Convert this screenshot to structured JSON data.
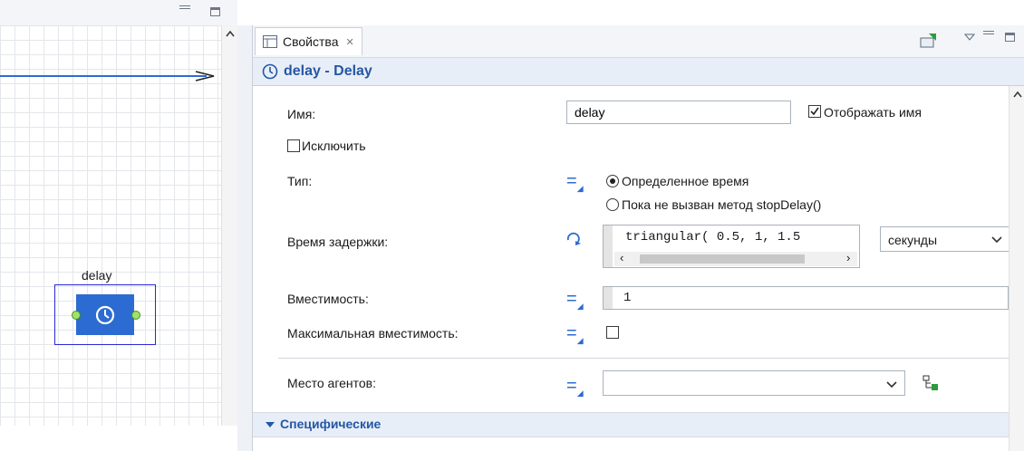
{
  "tab": {
    "label": "Свойства",
    "close": "✕"
  },
  "title": {
    "text": "delay - Delay"
  },
  "canvas": {
    "block_label": "delay"
  },
  "fields": {
    "name_label": "Имя:",
    "name_value": "delay",
    "show_name_label": "Отображать имя",
    "show_name_checked": true,
    "exclude_label": "Исключить",
    "exclude_checked": false,
    "type_label": "Тип:",
    "type_options": [
      "Определенное время",
      "Пока не вызван метод stopDelay()"
    ],
    "type_selected": 0,
    "delay_time_label": "Время задержки:",
    "delay_time_value": "triangular( 0.5, 1, 1.5",
    "delay_unit": "секунды",
    "capacity_label": "Вместимость:",
    "capacity_value": "1",
    "max_capacity_label": "Максимальная вместимость:",
    "max_capacity_checked": false,
    "agent_location_label": "Место агентов:",
    "agent_location_value": ""
  },
  "section": {
    "label": "Специфические"
  },
  "colors": {
    "accent": "#2357a5",
    "block_fill": "#2c6bd1",
    "canvas_grid": "#e3e6ea"
  },
  "icons": [
    "minimize-icon",
    "maximize-icon",
    "properties-tab-icon",
    "close-icon",
    "clock-icon",
    "equals-icon",
    "reload-icon",
    "dropdown-arrow-icon",
    "agent-location-icon",
    "section-collapse-icon"
  ]
}
